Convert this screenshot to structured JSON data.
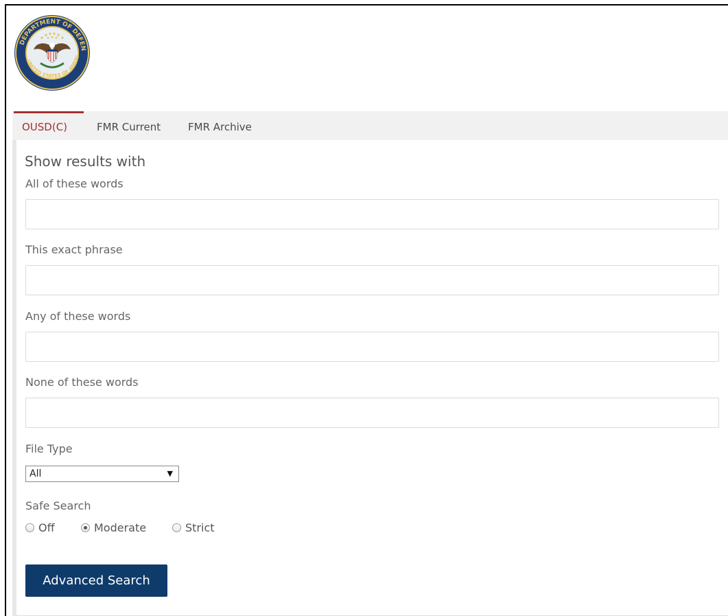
{
  "logo": {
    "name": "Department of Defense seal",
    "text": "DEPARTMENT OF DEFENSE · UNITED STATES OF AMERICA"
  },
  "nav": {
    "tabs": [
      {
        "label": "OUSD(C)",
        "active": true
      },
      {
        "label": "FMR Current",
        "active": false
      },
      {
        "label": "FMR Archive",
        "active": false
      }
    ],
    "active_color": "#a52f2f"
  },
  "form": {
    "heading": "Show results with",
    "fields": [
      {
        "label": "All of these words",
        "value": ""
      },
      {
        "label": "This exact phrase",
        "value": ""
      },
      {
        "label": "Any of these words",
        "value": ""
      },
      {
        "label": "None of these words",
        "value": ""
      }
    ],
    "file_type": {
      "label": "File Type",
      "selected": "All"
    },
    "safe_search": {
      "label": "Safe Search",
      "options": [
        {
          "label": "Off",
          "checked": false
        },
        {
          "label": "Moderate",
          "checked": true
        },
        {
          "label": "Strict",
          "checked": false
        }
      ]
    },
    "submit_label": "Advanced Search",
    "submit_color": "#0f3b6b"
  }
}
